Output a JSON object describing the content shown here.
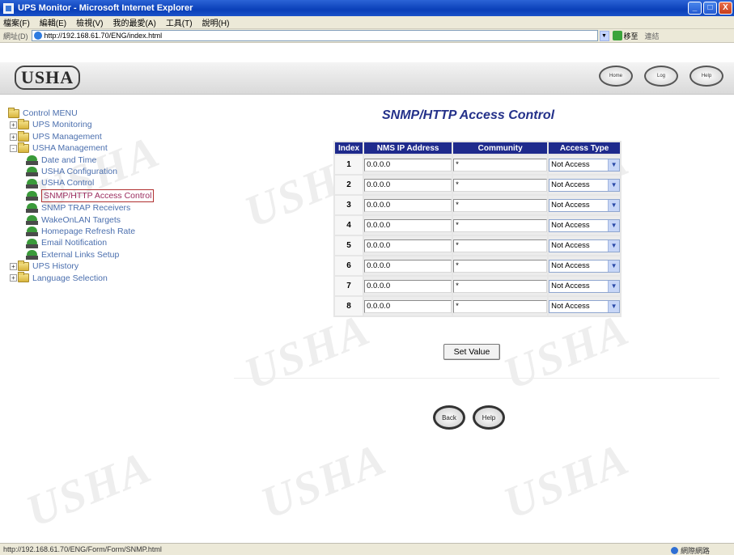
{
  "window": {
    "title": "UPS Monitor - Microsoft Internet Explorer",
    "buttons": [
      "_",
      "□",
      "X"
    ]
  },
  "menu": [
    "檔案(F)",
    "編輯(E)",
    "檢視(V)",
    "我的最愛(A)",
    "工具(T)",
    "說明(H)"
  ],
  "address": {
    "label": "網址(D)",
    "url": "http://192.168.61.70/ENG/index.html",
    "go_label": "移至",
    "links_label": "連結"
  },
  "header": {
    "logo": "USHA",
    "nav_buttons": [
      "Home",
      "Log",
      "Help"
    ]
  },
  "tree": {
    "root": "Control MENU",
    "items": [
      {
        "label": "UPS Monitoring",
        "type": "folder",
        "expander": "+"
      },
      {
        "label": "UPS Management",
        "type": "folder",
        "expander": "+"
      },
      {
        "label": "USHA Management",
        "type": "folder",
        "expander": "-"
      },
      {
        "label": "Date and Time",
        "type": "leaf"
      },
      {
        "label": "USHA Configuration",
        "type": "leaf"
      },
      {
        "label": "USHA Control",
        "type": "leaf"
      },
      {
        "label": "SNMP/HTTP Access Control",
        "type": "leaf",
        "selected": true
      },
      {
        "label": "SNMP TRAP Receivers",
        "type": "leaf"
      },
      {
        "label": "WakeOnLAN Targets",
        "type": "leaf"
      },
      {
        "label": "Homepage Refresh Rate",
        "type": "leaf"
      },
      {
        "label": "Email Notification",
        "type": "leaf"
      },
      {
        "label": "External Links Setup",
        "type": "leaf"
      },
      {
        "label": "UPS History",
        "type": "folder",
        "expander": "+"
      },
      {
        "label": "Language Selection",
        "type": "folder",
        "expander": "+"
      }
    ]
  },
  "main": {
    "title": "SNMP/HTTP Access Control",
    "columns": [
      "Index",
      "NMS IP Address",
      "Community",
      "Access Type"
    ],
    "rows": [
      {
        "index": "1",
        "ip": "0.0.0.0",
        "community": "*",
        "access": "Not Access"
      },
      {
        "index": "2",
        "ip": "0.0.0.0",
        "community": "*",
        "access": "Not Access"
      },
      {
        "index": "3",
        "ip": "0.0.0.0",
        "community": "*",
        "access": "Not Access"
      },
      {
        "index": "4",
        "ip": "0.0.0.0",
        "community": "*",
        "access": "Not Access"
      },
      {
        "index": "5",
        "ip": "0.0.0.0",
        "community": "*",
        "access": "Not Access"
      },
      {
        "index": "6",
        "ip": "0.0.0.0",
        "community": "*",
        "access": "Not Access"
      },
      {
        "index": "7",
        "ip": "0.0.0.0",
        "community": "*",
        "access": "Not Access"
      },
      {
        "index": "8",
        "ip": "0.0.0.0",
        "community": "*",
        "access": "Not Access"
      }
    ],
    "set_button": "Set Value",
    "back_button": "Back",
    "help_button": "Help"
  },
  "watermark": "USHA",
  "status": {
    "url": "http://192.168.61.70/ENG/Form/Form/SNMP.html",
    "zone": "網際網路"
  }
}
